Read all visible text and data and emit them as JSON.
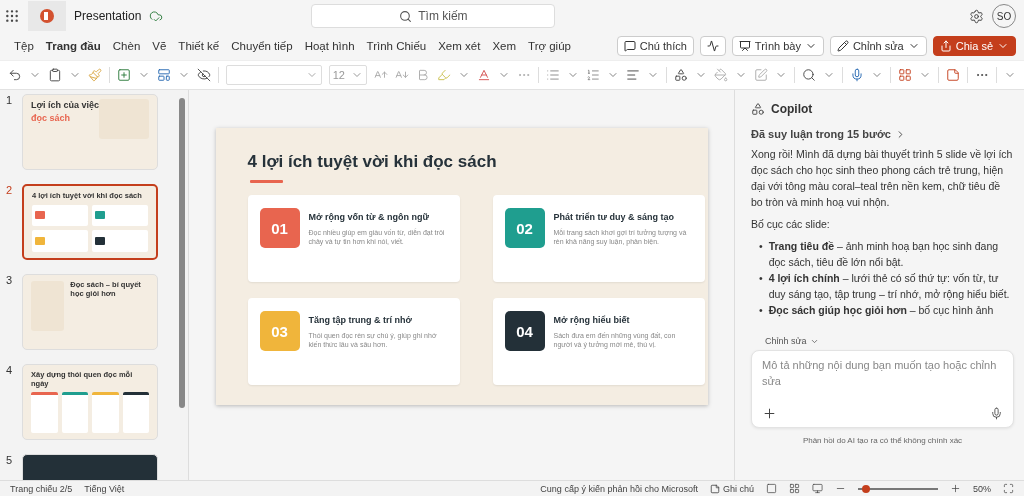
{
  "app": {
    "title": "Presentation",
    "search_placeholder": "Tìm kiếm",
    "avatar": "SO"
  },
  "menu": [
    {
      "label": "Tệp",
      "selected": false
    },
    {
      "label": "Trang đầu",
      "selected": true
    },
    {
      "label": "Chèn",
      "selected": false
    },
    {
      "label": "Vẽ",
      "selected": false
    },
    {
      "label": "Thiết kế",
      "selected": false
    },
    {
      "label": "Chuyển tiếp",
      "selected": false
    },
    {
      "label": "Hoạt hình",
      "selected": false
    },
    {
      "label": "Trình Chiếu",
      "selected": false
    },
    {
      "label": "Xem xét",
      "selected": false
    },
    {
      "label": "Xem",
      "selected": false
    },
    {
      "label": "Trợ giúp",
      "selected": false
    }
  ],
  "actions": [
    {
      "kind": "comment",
      "label": "Chú thích"
    },
    {
      "kind": "activity"
    },
    {
      "kind": "present",
      "label": "Trình bày"
    },
    {
      "kind": "edit",
      "label": "Chỉnh sửa"
    },
    {
      "kind": "share",
      "label": "Chia sẻ"
    }
  ],
  "toolbar": {
    "font_size": "12"
  },
  "thumbnails": [
    {
      "number": "1",
      "kind": "cover",
      "title": "Lợi ích của việc",
      "subtitle": "đọc sách",
      "selected": false
    },
    {
      "number": "2",
      "kind": "cards",
      "title": "4 lợi ích tuyệt vời khi đọc sách",
      "selected": true
    },
    {
      "number": "3",
      "kind": "split",
      "title": "Đọc sách – bí quyết học giỏi hơn",
      "selected": false
    },
    {
      "number": "4",
      "kind": "steps",
      "title": "Xây dựng thói quen đọc mỗi ngày",
      "selected": false
    },
    {
      "number": "5",
      "kind": "dark",
      "selected": false
    }
  ],
  "slide": {
    "title": "4 lợi ích tuyệt vời khi đọc sách",
    "cards": [
      {
        "number": "01",
        "heading": "Mở rộng vốn từ & ngôn ngữ",
        "body": "Đọc nhiều giúp em giàu vốn từ, diễn đạt trôi chảy và tự tin hơn khi nói, viết.",
        "color": "#e8654f"
      },
      {
        "number": "02",
        "heading": "Phát triển tư duy & sáng tạo",
        "body": "Mỗi trang sách khơi gợi trí tưởng tượng và rèn khả năng suy luận, phản biện.",
        "color": "#1f9e8f"
      },
      {
        "number": "03",
        "heading": "Tăng tập trung & trí nhớ",
        "body": "Thói quen đọc rèn sự chú ý, giúp ghi nhớ kiến thức lâu và sâu hơn.",
        "color": "#f0b53b"
      },
      {
        "number": "04",
        "heading": "Mở rộng hiểu biết",
        "body": "Sách đưa em đến những vùng đất, con người và ý tưởng mới mẻ, thú vị.",
        "color": "#233038"
      }
    ]
  },
  "copilot": {
    "title": "Copilot",
    "reasoning": "Đã suy luận trong 15 bước",
    "intro": "Xong rồi! Mình đã dựng bài thuyết trình 5 slide về lợi ích đọc sách cho học sinh theo phong cách trẻ trung, hiện đại với tông màu coral–teal trên nền kem, chữ tiêu đề bo tròn và minh hoạ vui nhộn.",
    "layout_label": "Bố cục các slide:",
    "bullets": [
      {
        "marker": "•",
        "text": "**Trang tiêu đề** – ảnh minh hoạ bạn học sinh đang đọc sách, tiêu đề lớn nổi bật."
      },
      {
        "marker": "•",
        "text": "**4 lợi ích chính** – lưới thẻ có số thứ tự: vốn từ, tư duy sáng tạo, tập trung – trí nhớ, mở rộng hiểu biết."
      },
      {
        "marker": "•",
        "text": "**Đọc sách giúp học giỏi hơn** – bố cục hình ảnh"
      }
    ],
    "edit_label": "Chỉnh sửa",
    "input_placeholder": "Mô tả những nội dung bạn muốn tạo hoặc chỉnh sửa",
    "disclaimer": "Phản hồi do AI tạo ra có thể không chính xác"
  },
  "status": {
    "slide": "Trang chiếu 2/5",
    "language": "Tiếng Việt",
    "feedback": "Cung cấp ý kiến phản hồi cho Microsoft",
    "notes": "Ghi chú",
    "zoom": "50%",
    "zoom_slider": {
      "level": 0.1
    }
  }
}
